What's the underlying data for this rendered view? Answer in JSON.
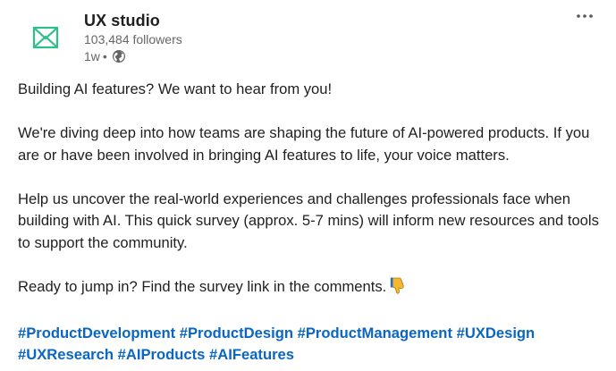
{
  "author": {
    "name": "UX studio",
    "followers": "103,484 followers",
    "time": "1w",
    "separator": "•",
    "logo_icon": "ux-studio-logo",
    "visibility_icon": "globe-icon",
    "brand_color": "#2fbf8a"
  },
  "menu": {
    "more_label": "···"
  },
  "post": {
    "paragraphs": [
      "Building AI features? We want to hear from you!",
      "We're diving deep into how teams are shaping the future of AI-powered products. If you are or have been involved in bringing AI features to life, your voice matters.",
      "Help us uncover the real-world experiences and challenges professionals face when building with AI. This quick survey (approx. 5-7 mins) will inform new resources and tools to support the community.",
      "Ready to jump in? Find the survey link in the comments."
    ],
    "emoji_icon": "pointing-down-hand-icon",
    "hashtags": [
      "#ProductDevelopment",
      "#ProductDesign",
      "#ProductManagement",
      "#UXDesign",
      "#UXResearch",
      "#AIProducts",
      "#AIFeatures"
    ],
    "hashtag_color": "#0a66c2"
  }
}
